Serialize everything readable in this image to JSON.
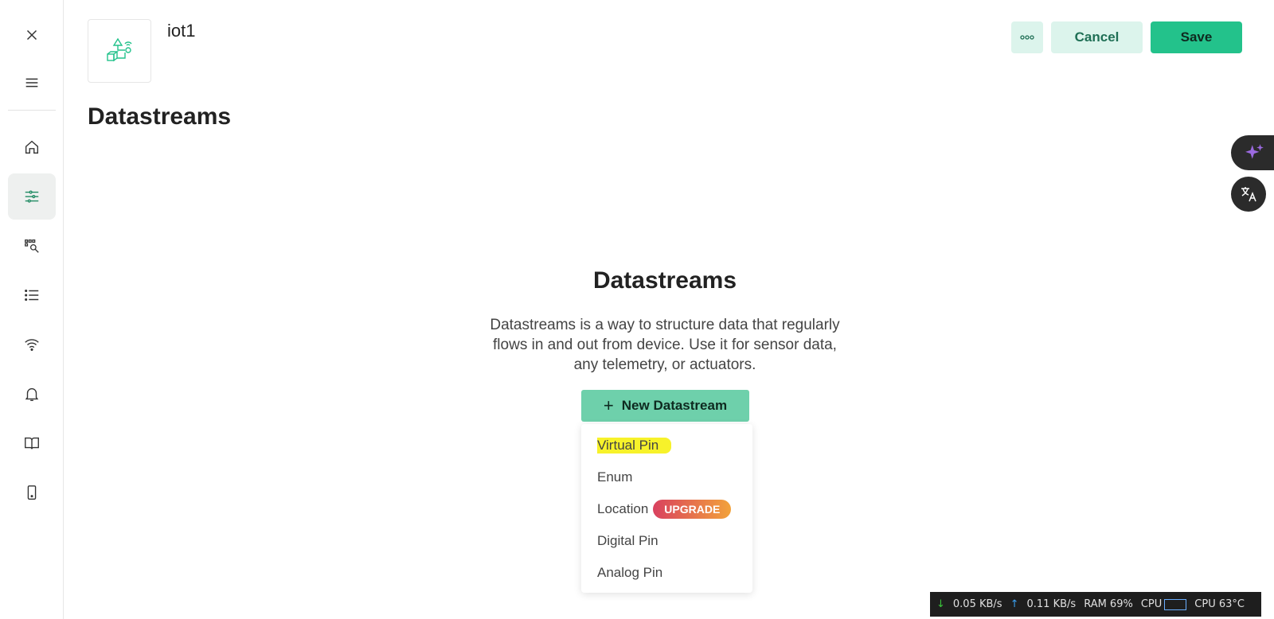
{
  "header": {
    "template_name": "iot1",
    "more_icon": "more-dots-icon",
    "cancel_label": "Cancel",
    "save_label": "Save"
  },
  "page": {
    "title": "Datastreams"
  },
  "sidebar": {
    "items": [
      {
        "icon": "close-icon"
      },
      {
        "icon": "menu-icon"
      },
      {
        "icon": "home-icon"
      },
      {
        "icon": "datastreams-icon",
        "active": true
      },
      {
        "icon": "search-devices-icon"
      },
      {
        "icon": "list-icon"
      },
      {
        "icon": "wifi-icon"
      },
      {
        "icon": "bell-icon"
      },
      {
        "icon": "book-icon"
      },
      {
        "icon": "mobile-icon"
      }
    ]
  },
  "empty_state": {
    "title": "Datastreams",
    "description": "Datastreams is a way to structure data that regularly flows in and out from device. Use it for sensor data, any telemetry, or actuators.",
    "button_label": "New Datastream"
  },
  "dropdown": {
    "items": [
      "Virtual Pin",
      "Enum",
      "Location",
      "Digital Pin",
      "Analog Pin"
    ],
    "upgrade_badge": "UPGRADE"
  },
  "statusbar": {
    "download": "0.05 KB/s",
    "upload": "0.11 KB/s",
    "ram": "RAM 69%",
    "cpu_label": "CPU",
    "cpu_temp": "CPU 63°C"
  },
  "colors": {
    "accent": "#23c28b",
    "accent_light": "#dcf4ec",
    "highlight": "#f7f22a"
  }
}
